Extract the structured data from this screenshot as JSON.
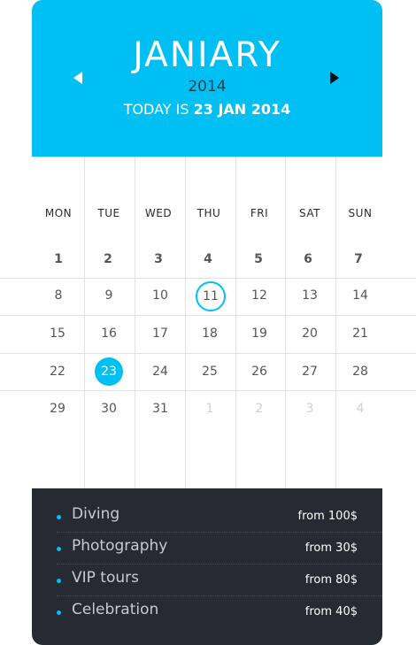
{
  "header": {
    "month": "JANIARY",
    "year": "2014",
    "today_prefix": "TODAY IS ",
    "today_date": "23 JAN 2014"
  },
  "weekdays": [
    "MON",
    "TUE",
    "WED",
    "THU",
    "FRI",
    "SAT",
    "SUN"
  ],
  "weeks": [
    [
      "1",
      "2",
      "3",
      "4",
      "5",
      "6",
      "7"
    ],
    [
      "8",
      "9",
      "10",
      "11",
      "12",
      "13",
      "14"
    ],
    [
      "15",
      "16",
      "17",
      "18",
      "19",
      "20",
      "21"
    ],
    [
      "22",
      "23",
      "24",
      "25",
      "26",
      "27",
      "28"
    ],
    [
      "29",
      "30",
      "31",
      "1",
      "2",
      "3",
      "4"
    ]
  ],
  "highlighted_day": "11",
  "selected_day": "23",
  "colors": {
    "accent": "#00bff3",
    "panel": "#262a33"
  },
  "events": [
    {
      "name": "Diving",
      "price": "from 100$"
    },
    {
      "name": "Photography",
      "price": "from 30$"
    },
    {
      "name": "VIP tours",
      "price": "from 80$"
    },
    {
      "name": "Celebration",
      "price": "from 40$"
    }
  ]
}
